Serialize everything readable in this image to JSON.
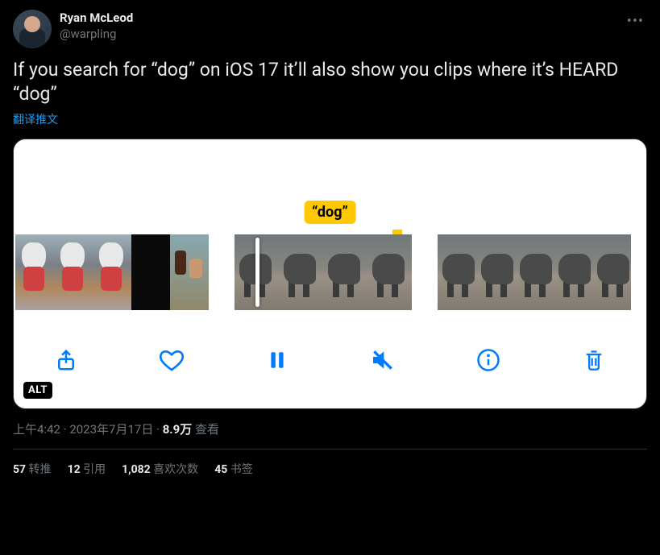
{
  "author": {
    "display_name": "Ryan McLeod",
    "handle": "@warpling"
  },
  "tweet_text": "If you search for “dog” on iOS 17 it’ll also show you clips where it’s HEARD “dog”",
  "translate_label": "翻译推文",
  "media": {
    "search_label": "“dog”",
    "alt_badge": "ALT",
    "toolbar_icons": [
      "share",
      "heart",
      "pause",
      "mute",
      "info",
      "trash"
    ]
  },
  "meta": {
    "time": "上午4:42",
    "date": "2023年7月17日",
    "dot": " · ",
    "views_count": "8.9万",
    "views_label": " 查看"
  },
  "stats": {
    "retweets": {
      "count": "57",
      "label": " 转推"
    },
    "quotes": {
      "count": "12",
      "label": " 引用"
    },
    "likes": {
      "count": "1,082",
      "label": " 喜欢次数"
    },
    "bookmarks": {
      "count": "45",
      "label": " 书签"
    }
  }
}
